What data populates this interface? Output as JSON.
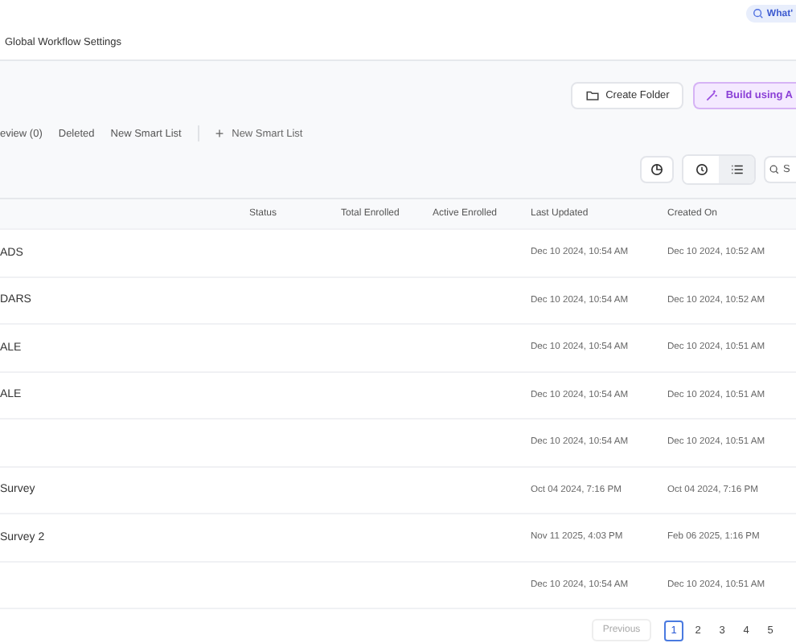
{
  "header": {
    "whats_new": "What'",
    "title": "Global Workflow Settings"
  },
  "actions": {
    "create_folder": "Create Folder",
    "build": "Build using A"
  },
  "tabs": [
    {
      "label": "eview (0)",
      "selected": false
    },
    {
      "label": "Deleted",
      "selected": false
    },
    {
      "label": "New Smart List",
      "selected": false
    }
  ],
  "add_list": {
    "icon": "+",
    "label": "New Smart List"
  },
  "view_toggle": [
    {
      "kind": "clock",
      "selected": false
    },
    {
      "kind": "list",
      "selected": true
    }
  ],
  "search": {
    "placeholder": "S"
  },
  "table": {
    "columns": [
      "Status",
      "Total Enrolled",
      "Active Enrolled",
      "Last Updated",
      "Created On"
    ],
    "rows": [
      {
        "name": "ADS",
        "last_updated": "Dec 10 2024, 10:54 AM",
        "created_on": "Dec 10 2024, 10:52 AM"
      },
      {
        "name": "DARS",
        "last_updated": "Dec 10 2024, 10:54 AM",
        "created_on": "Dec 10 2024, 10:52 AM"
      },
      {
        "name": "ALE",
        "last_updated": "Dec 10 2024, 10:54 AM",
        "created_on": "Dec 10 2024, 10:51 AM"
      },
      {
        "name": "ALE",
        "last_updated": "Dec 10 2024, 10:54 AM",
        "created_on": "Dec 10 2024, 10:51 AM"
      },
      {
        "name": "",
        "last_updated": "Dec 10 2024, 10:54 AM",
        "created_on": "Dec 10 2024, 10:51 AM"
      },
      {
        "name": "Survey",
        "last_updated": "Oct 04 2024, 7:16 PM",
        "created_on": "Oct 04 2024, 7:16 PM"
      },
      {
        "name": "Survey 2",
        "last_updated": "Nov 11 2025, 4:03 PM",
        "created_on": "Feb 06 2025, 1:16 PM"
      },
      {
        "name": "",
        "last_updated": "Dec 10 2024, 10:54 AM",
        "created_on": "Dec 10 2024, 10:51 AM"
      }
    ]
  },
  "pagination": {
    "previous": "Previous",
    "pages": [
      {
        "label": "1",
        "selected": true
      },
      {
        "label": "2",
        "selected": false
      },
      {
        "label": "3",
        "selected": false
      },
      {
        "label": "4",
        "selected": false
      },
      {
        "label": "5",
        "selected": false
      }
    ]
  }
}
